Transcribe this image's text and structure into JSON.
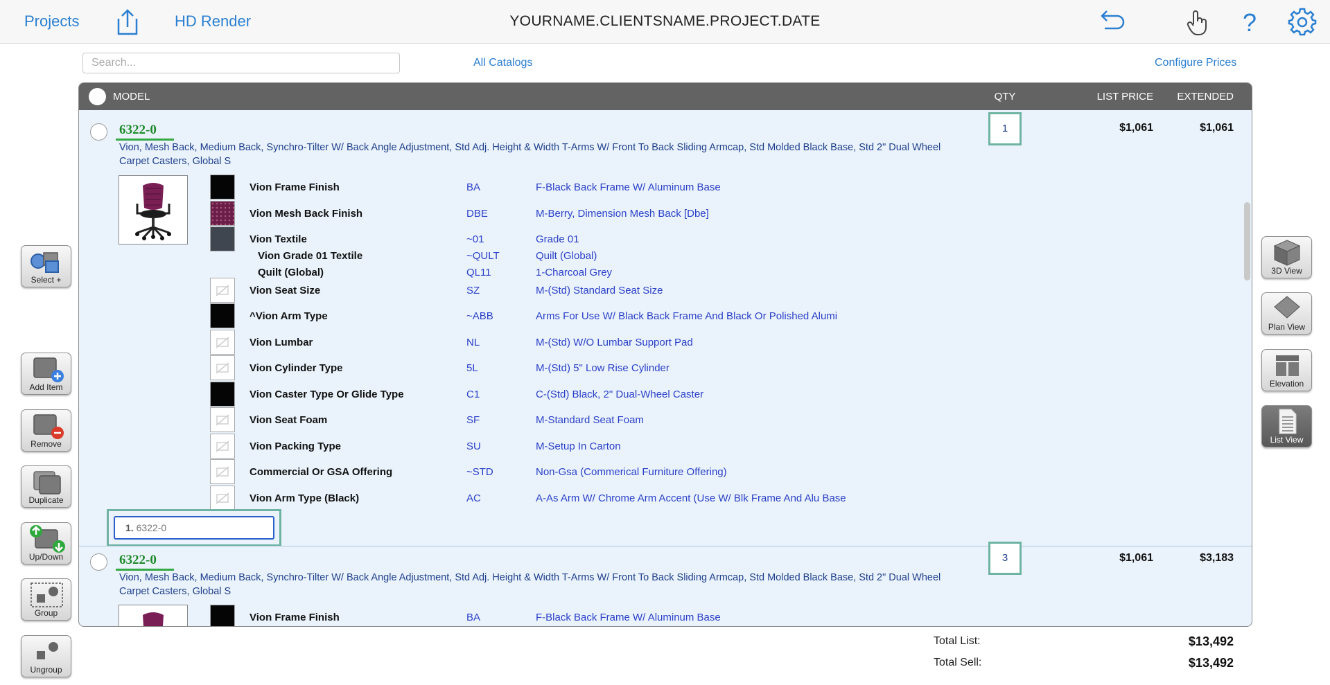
{
  "topbar": {
    "projects": "Projects",
    "hd_render": "HD Render",
    "title": "YOURNAME.CLIENTSNAME.PROJECT.DATE"
  },
  "toolbar": {
    "search_placeholder": "Search...",
    "all_catalogs": "All Catalogs",
    "configure_prices": "Configure Prices"
  },
  "table": {
    "headers": {
      "model": "MODEL",
      "qty": "QTY",
      "list_price": "LIST PRICE",
      "extended": "EXTENDED"
    }
  },
  "items": [
    {
      "model": "6322-0",
      "description_line1": "Vion, Mesh Back, Medium Back, Synchro-Tilter W/ Back Angle Adjustment, Std Adj. Height & Width T-Arms W/ Front To Back Sliding Armcap, Std Molded Black Base, Std 2\" Dual Wheel",
      "description_line2": "Carpet Casters, Global S",
      "qty": "1",
      "list_price": "$1,061",
      "extended": "$1,061",
      "tag_number": "1.",
      "tag_label": "6322-0",
      "options": [
        {
          "name": "Vion Frame Finish",
          "code": "BA",
          "desc": "F-Black Back Frame W/ Aluminum Base",
          "swatch": "#050505"
        },
        {
          "name": "Vion Mesh Back Finish",
          "code": "DBE",
          "desc": "M-Berry, Dimension Mesh Back [Dbe]",
          "swatch": "#6b1f48"
        },
        {
          "name": "Vion Textile",
          "code": "~01",
          "desc": "Grade 01",
          "swatch": "#3f4650"
        },
        {
          "name": "Vion Grade 01 Textile",
          "code": "~QULT",
          "desc": "Quilt (Global)",
          "swatch": "none"
        },
        {
          "name": "Quilt (Global)",
          "code": "QL11",
          "desc": "1-Charcoal Grey",
          "swatch": "none"
        },
        {
          "name": "Vion Seat Size",
          "code": "SZ",
          "desc": "M-(Std) Standard Seat Size",
          "swatch": "no-image"
        },
        {
          "name": "^Vion Arm Type",
          "code": "~ABB",
          "desc": "Arms For Use W/ Black Back Frame And Black Or Polished Alumi",
          "swatch": "#050505"
        },
        {
          "name": "Vion Lumbar",
          "code": "NL",
          "desc": "M-(Std) W/O Lumbar Support Pad",
          "swatch": "no-image"
        },
        {
          "name": "Vion Cylinder Type",
          "code": "5L",
          "desc": "M-(Std) 5\" Low Rise Cylinder",
          "swatch": "no-image"
        },
        {
          "name": "Vion Caster Type Or Glide Type",
          "code": "C1",
          "desc": "C-(Std) Black, 2\" Dual-Wheel Caster",
          "swatch": "#050505"
        },
        {
          "name": "Vion Seat Foam",
          "code": "SF",
          "desc": "M-Standard Seat Foam",
          "swatch": "no-image"
        },
        {
          "name": "Vion Packing Type",
          "code": "SU",
          "desc": "M-Setup In Carton",
          "swatch": "no-image"
        },
        {
          "name": "Commercial Or GSA Offering",
          "code": "~STD",
          "desc": "Non-Gsa (Commerical Furniture Offering)",
          "swatch": "no-image"
        },
        {
          "name": "Vion Arm Type (Black)",
          "code": "AC",
          "desc": "A-As Arm W/ Chrome Arm Accent (Use W/ Blk Frame And Alu Base",
          "swatch": "no-image"
        }
      ]
    },
    {
      "model": "6322-0",
      "description_line1": "Vion, Mesh Back, Medium Back, Synchro-Tilter W/ Back Angle Adjustment, Std Adj. Height & Width T-Arms W/ Front To Back Sliding Armcap, Std Molded Black Base, Std 2\" Dual Wheel",
      "description_line2": "Carpet Casters, Global S",
      "qty": "3",
      "list_price": "$1,061",
      "extended": "$3,183",
      "options": [
        {
          "name": "Vion Frame Finish",
          "code": "BA",
          "desc": "F-Black Back Frame W/ Aluminum Base",
          "swatch": "#050505"
        }
      ]
    }
  ],
  "totals": {
    "list_label": "Total List:",
    "list_value": "$13,492",
    "sell_label": "Total Sell:",
    "sell_value": "$13,492"
  },
  "left_tools": {
    "select": "Select +",
    "add_item": "Add Item",
    "remove": "Remove",
    "duplicate": "Duplicate",
    "up_down": "Up/Down",
    "group": "Group",
    "ungroup": "Ungroup"
  },
  "right_views": {
    "view_3d": "3D View",
    "plan": "Plan View",
    "elevation": "Elevation",
    "list": "List View"
  },
  "colors": {
    "accent_blue": "#2a7fd1",
    "model_green": "#1f8a2a",
    "highlight_teal": "#6fb3a3",
    "header_gray": "#636363"
  }
}
